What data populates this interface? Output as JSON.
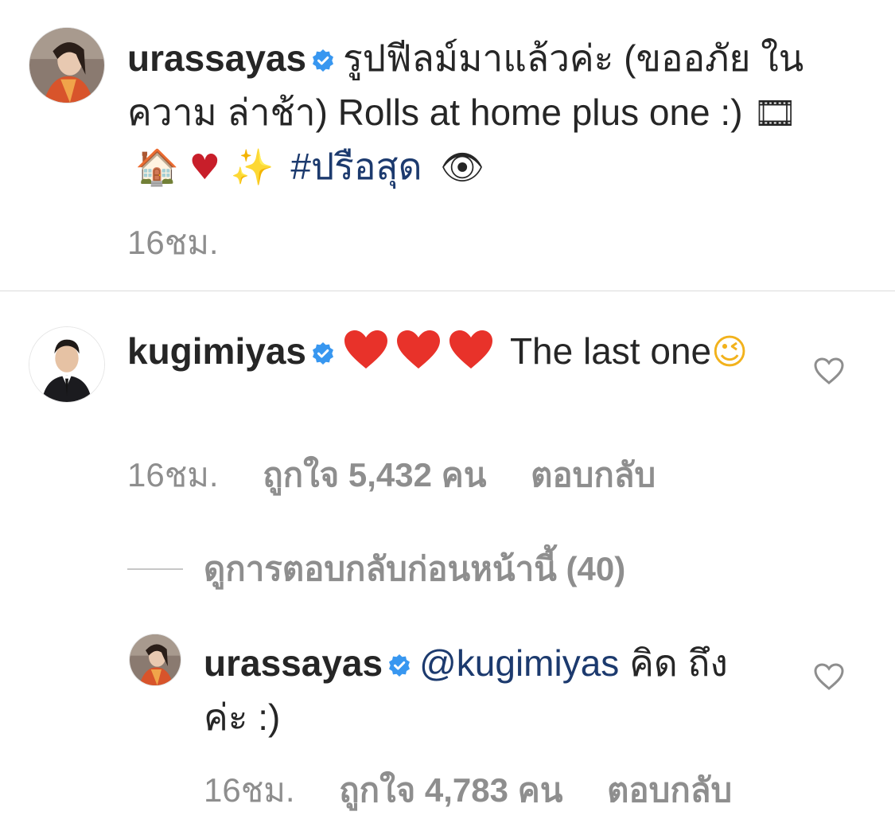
{
  "caption": {
    "username": "urassayas",
    "text_thai": "รูปฟีลม์มาแล้วค่ะ (ขออภัย ในความ ล่าช้า)",
    "text_english": "Rolls at home plus one :)",
    "emojis": [
      "🎞",
      "🏠",
      "♥",
      "✨"
    ],
    "hashtag": "#ปรือสุด",
    "trailing_emoji": "👁",
    "time": "16ชม."
  },
  "comment": {
    "username": "kugimiyas",
    "text": "The last one",
    "emoji": "😉",
    "time": "16ชม.",
    "likes": "ถูกใจ 5,432 คน",
    "reply_label": "ตอบกลับ"
  },
  "view_replies": {
    "label": "ดูการตอบกลับก่อนหน้านี้ (40)"
  },
  "reply": {
    "username": "urassayas",
    "mention": "@kugimiyas",
    "text": "คิด ถึง ค่ะ :)",
    "time": "16ชม.",
    "likes": "ถูกใจ 4,783 คน",
    "reply_label": "ตอบกลับ"
  },
  "colors": {
    "verified_blue": "#3897f0",
    "hashtag": "#1c3a6e",
    "meta_gray": "#8e8e8e",
    "heart_red": "#ed4956"
  },
  "icons": {
    "verified": "verified-badge-icon",
    "like": "heart-outline-icon"
  }
}
